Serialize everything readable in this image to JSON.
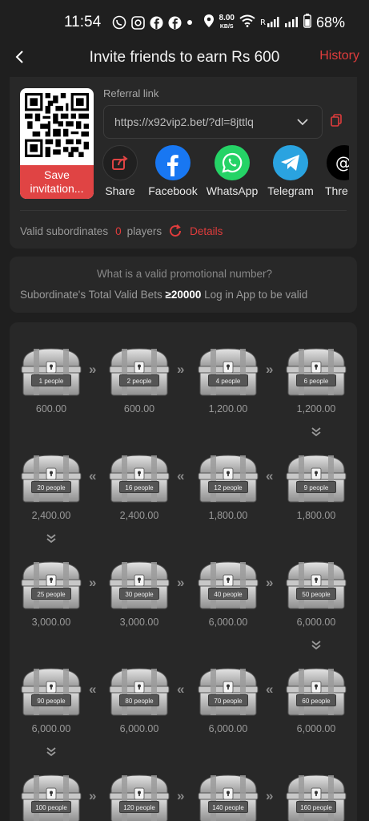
{
  "status_bar": {
    "time": "11:54",
    "speed_value": "8.00",
    "speed_unit": "KB/S",
    "battery": "68%"
  },
  "header": {
    "title": "Invite friends to earn Rs 600",
    "history_label": "History"
  },
  "referral": {
    "save_label_line1": "Save",
    "save_label_line2": "invitation...",
    "link_label": "Referral link",
    "link_value": "https://x92vip2.bet/?dl=8jttlq"
  },
  "share": [
    {
      "label": "Share",
      "icon": "share-arrow-icon"
    },
    {
      "label": "Facebook",
      "icon": "facebook-icon"
    },
    {
      "label": "WhatsApp",
      "icon": "whatsapp-icon"
    },
    {
      "label": "Telegram",
      "icon": "telegram-icon"
    },
    {
      "label": "Thre",
      "icon": "threads-icon"
    }
  ],
  "subordinates": {
    "label": "Valid subordinates",
    "count": "0",
    "unit": "players",
    "details_label": "Details"
  },
  "promo": {
    "question": "What is a valid promotional number?",
    "cond_prefix": "Subordinate's Total Valid Bets ",
    "cond_value": "≥20000",
    "cond_suffix": " Log in App to be valid"
  },
  "rewards": [
    {
      "people": "1 people",
      "amount": "600.00"
    },
    {
      "people": "2 people",
      "amount": "600.00"
    },
    {
      "people": "4 people",
      "amount": "1,200.00"
    },
    {
      "people": "6 people",
      "amount": "1,200.00"
    },
    {
      "people": "9 people",
      "amount": "1,800.00"
    },
    {
      "people": "12 people",
      "amount": "1,800.00"
    },
    {
      "people": "16 people",
      "amount": "2,400.00"
    },
    {
      "people": "20 people",
      "amount": "2,400.00"
    },
    {
      "people": "25 people",
      "amount": "3,000.00"
    },
    {
      "people": "30 people",
      "amount": "3,000.00"
    },
    {
      "people": "40 people",
      "amount": "6,000.00"
    },
    {
      "people": "50 people",
      "amount": "6,000.00"
    },
    {
      "people": "60 people",
      "amount": "6,000.00"
    },
    {
      "people": "70 people",
      "amount": "6,000.00"
    },
    {
      "people": "80 people",
      "amount": "6,000.00"
    },
    {
      "people": "90 people",
      "amount": "6,000.00"
    },
    {
      "people": "100 people",
      "amount": ""
    },
    {
      "people": "120 people",
      "amount": ""
    },
    {
      "people": "140 people",
      "amount": ""
    },
    {
      "people": "160 people",
      "amount": ""
    }
  ],
  "colors": {
    "accent": "#e03c3c",
    "background": "#1f1f1f",
    "card": "#282828"
  }
}
